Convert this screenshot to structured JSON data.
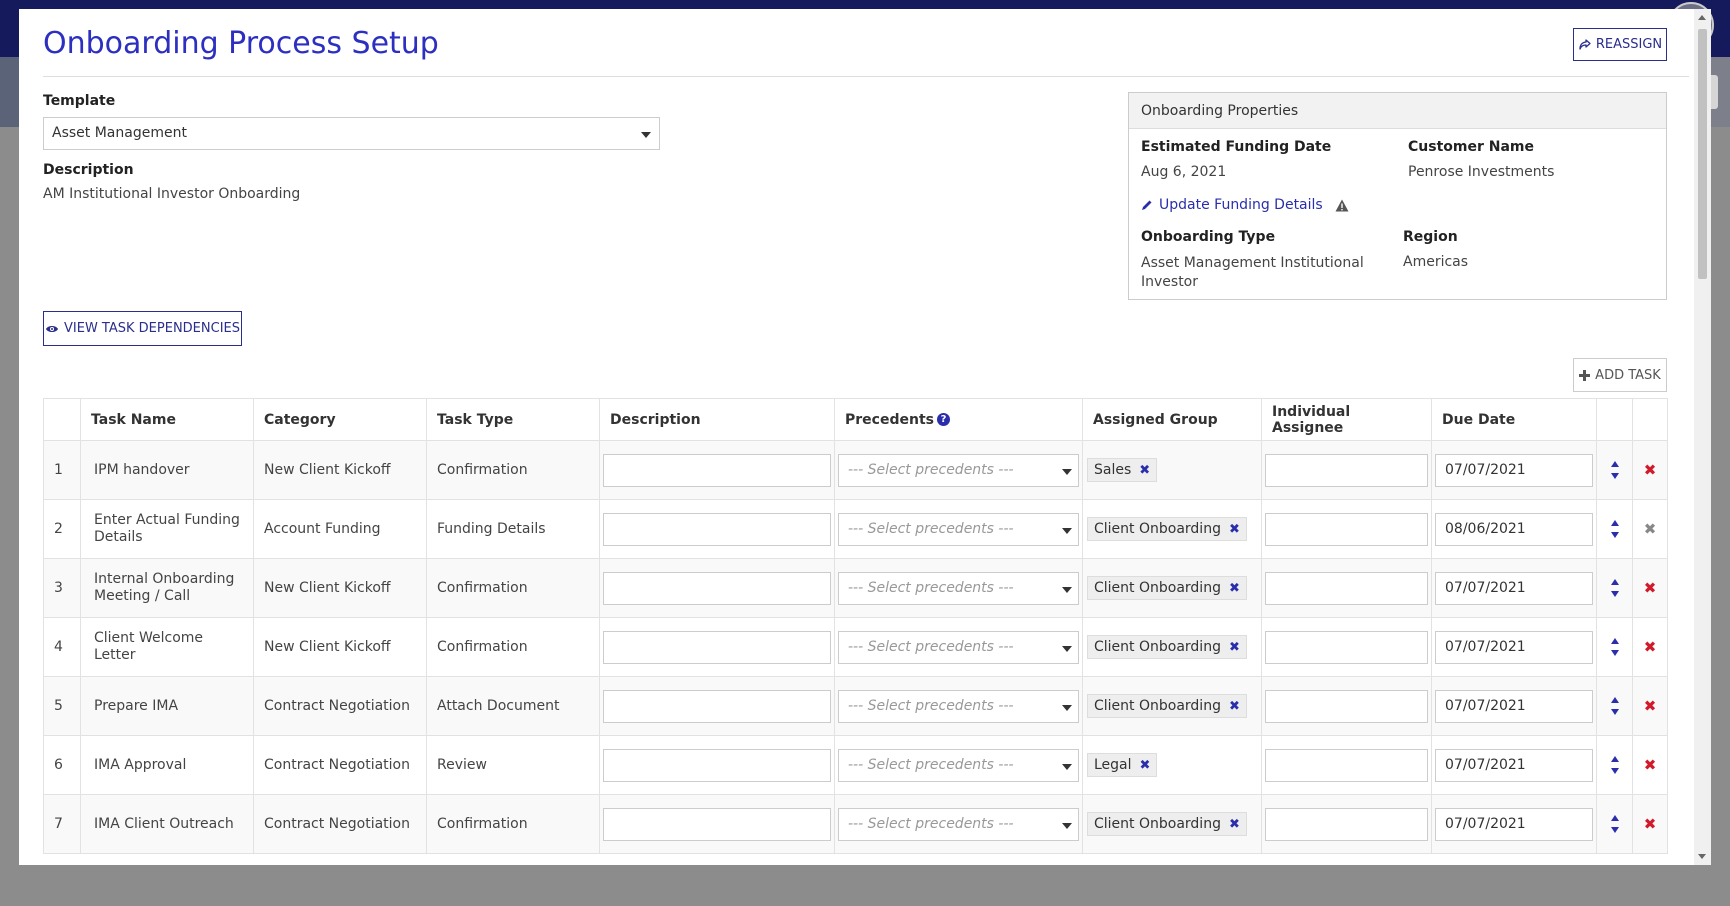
{
  "modal": {
    "title": "Onboarding Process Setup",
    "reassign_label": "REASSIGN"
  },
  "template": {
    "label": "Template",
    "value": "Asset Management",
    "description_label": "Description",
    "description_value": "AM Institutional Investor Onboarding"
  },
  "properties": {
    "header": "Onboarding Properties",
    "estimated_funding_date_label": "Estimated Funding Date",
    "estimated_funding_date": "Aug 6, 2021",
    "customer_name_label": "Customer Name",
    "customer_name": "Penrose Investments",
    "update_link": "Update Funding Details",
    "onboarding_type_label": "Onboarding Type",
    "onboarding_type": "Asset Management Institutional Investor",
    "region_label": "Region",
    "region": "Americas"
  },
  "buttons": {
    "view_dependencies": "VIEW TASK DEPENDENCIES",
    "add_task": "ADD TASK"
  },
  "table": {
    "headers": {
      "task_name": "Task Name",
      "category": "Category",
      "task_type": "Task Type",
      "description": "Description",
      "precedents": "Precedents",
      "assigned_group": "Assigned Group",
      "individual_assignee": "Individual Assignee",
      "due_date": "Due Date"
    },
    "precedent_placeholder": "--- Select precedents ---",
    "rows": [
      {
        "num": "1",
        "task": "IPM handover",
        "category": "New Client Kickoff",
        "type": "Confirmation",
        "group": "Sales",
        "due": "07/07/2021"
      },
      {
        "num": "2",
        "task": "Enter Actual Funding Details",
        "category": "Account Funding",
        "type": "Funding Details",
        "group": "Client Onboarding",
        "due": "08/06/2021"
      },
      {
        "num": "3",
        "task": "Internal Onboarding Meeting / Call",
        "category": "New Client Kickoff",
        "type": "Confirmation",
        "group": "Client Onboarding",
        "due": "07/07/2021"
      },
      {
        "num": "4",
        "task": "Client Welcome Letter",
        "category": "New Client Kickoff",
        "type": "Confirmation",
        "group": "Client Onboarding",
        "due": "07/07/2021"
      },
      {
        "num": "5",
        "task": "Prepare IMA",
        "category": "Contract Negotiation",
        "type": "Attach Document",
        "group": "Client Onboarding",
        "due": "07/07/2021"
      },
      {
        "num": "6",
        "task": "IMA Approval",
        "category": "Contract Negotiation",
        "type": "Review",
        "group": "Legal",
        "due": "07/07/2021"
      },
      {
        "num": "7",
        "task": "IMA Client Outreach",
        "category": "Contract Negotiation",
        "type": "Confirmation",
        "group": "Client Onboarding",
        "due": "07/07/2021"
      }
    ]
  },
  "colors": {
    "accent": "#2c2fbf",
    "topbar": "#141a5c",
    "delete": "#d11a2a"
  },
  "icons": {
    "reassign": "share-icon",
    "view": "eye-icon",
    "add": "plus-icon",
    "edit": "pencil-icon",
    "warning": "warning-icon",
    "help": "question-circle-icon"
  }
}
